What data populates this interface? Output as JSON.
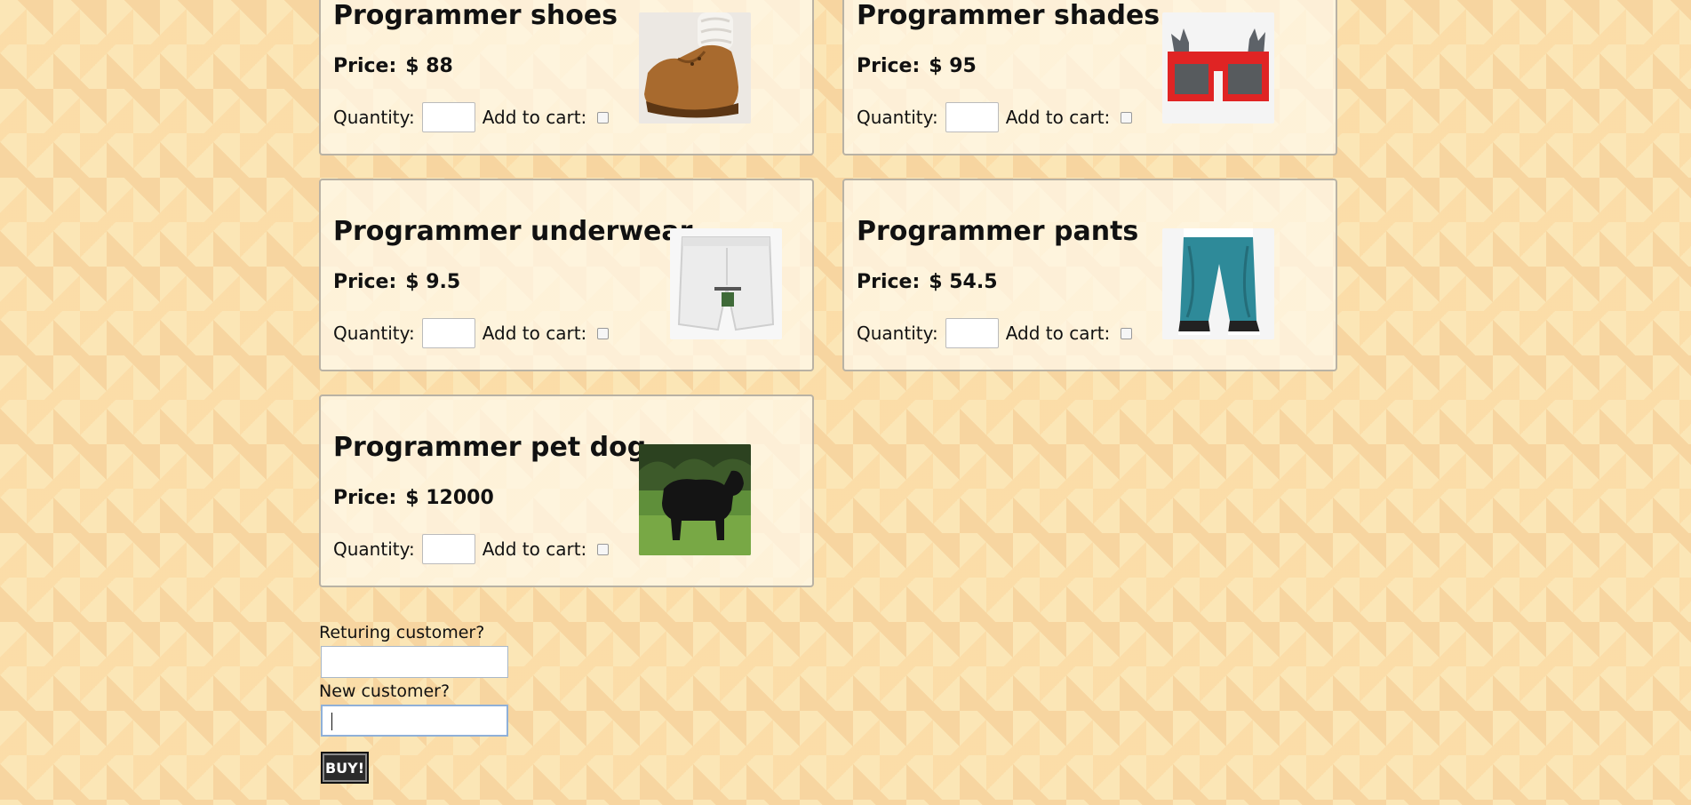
{
  "products": [
    {
      "name": "Programmer shoes",
      "price_label": "Price:",
      "price": "$ 88",
      "quantity_label": "Quantity:",
      "cart_label": "Add to cart:",
      "image": "brown-shoe-photo"
    },
    {
      "name": "Programmer shades",
      "price_label": "Price:",
      "price": "$ 95",
      "quantity_label": "Quantity:",
      "cart_label": "Add to cart:",
      "image": "pixel-sunglasses-photo"
    },
    {
      "name": "Programmer underwear",
      "price_label": "Price:",
      "price": "$ 9.5",
      "quantity_label": "Quantity:",
      "cart_label": "Add to cart:",
      "image": "white-boxers-photo"
    },
    {
      "name": "Programmer pants",
      "price_label": "Price:",
      "price": "$ 54.5",
      "quantity_label": "Quantity:",
      "cart_label": "Add to cart:",
      "image": "teal-sweatpants-photo"
    },
    {
      "name": "Programmer pet dog",
      "price_label": "Price:",
      "price": "$ 12000",
      "quantity_label": "Quantity:",
      "cart_label": "Add to cart:",
      "image": "black-dog-photo"
    }
  ],
  "form": {
    "returning_label": "Returing customer?",
    "returning_value": "",
    "new_label": "New customer?",
    "new_value": "",
    "buy_label": "BUY!"
  },
  "colors": {
    "background": "#fbe6b6",
    "card_border": "#b9b2a4",
    "button": "#2b2b2b"
  }
}
